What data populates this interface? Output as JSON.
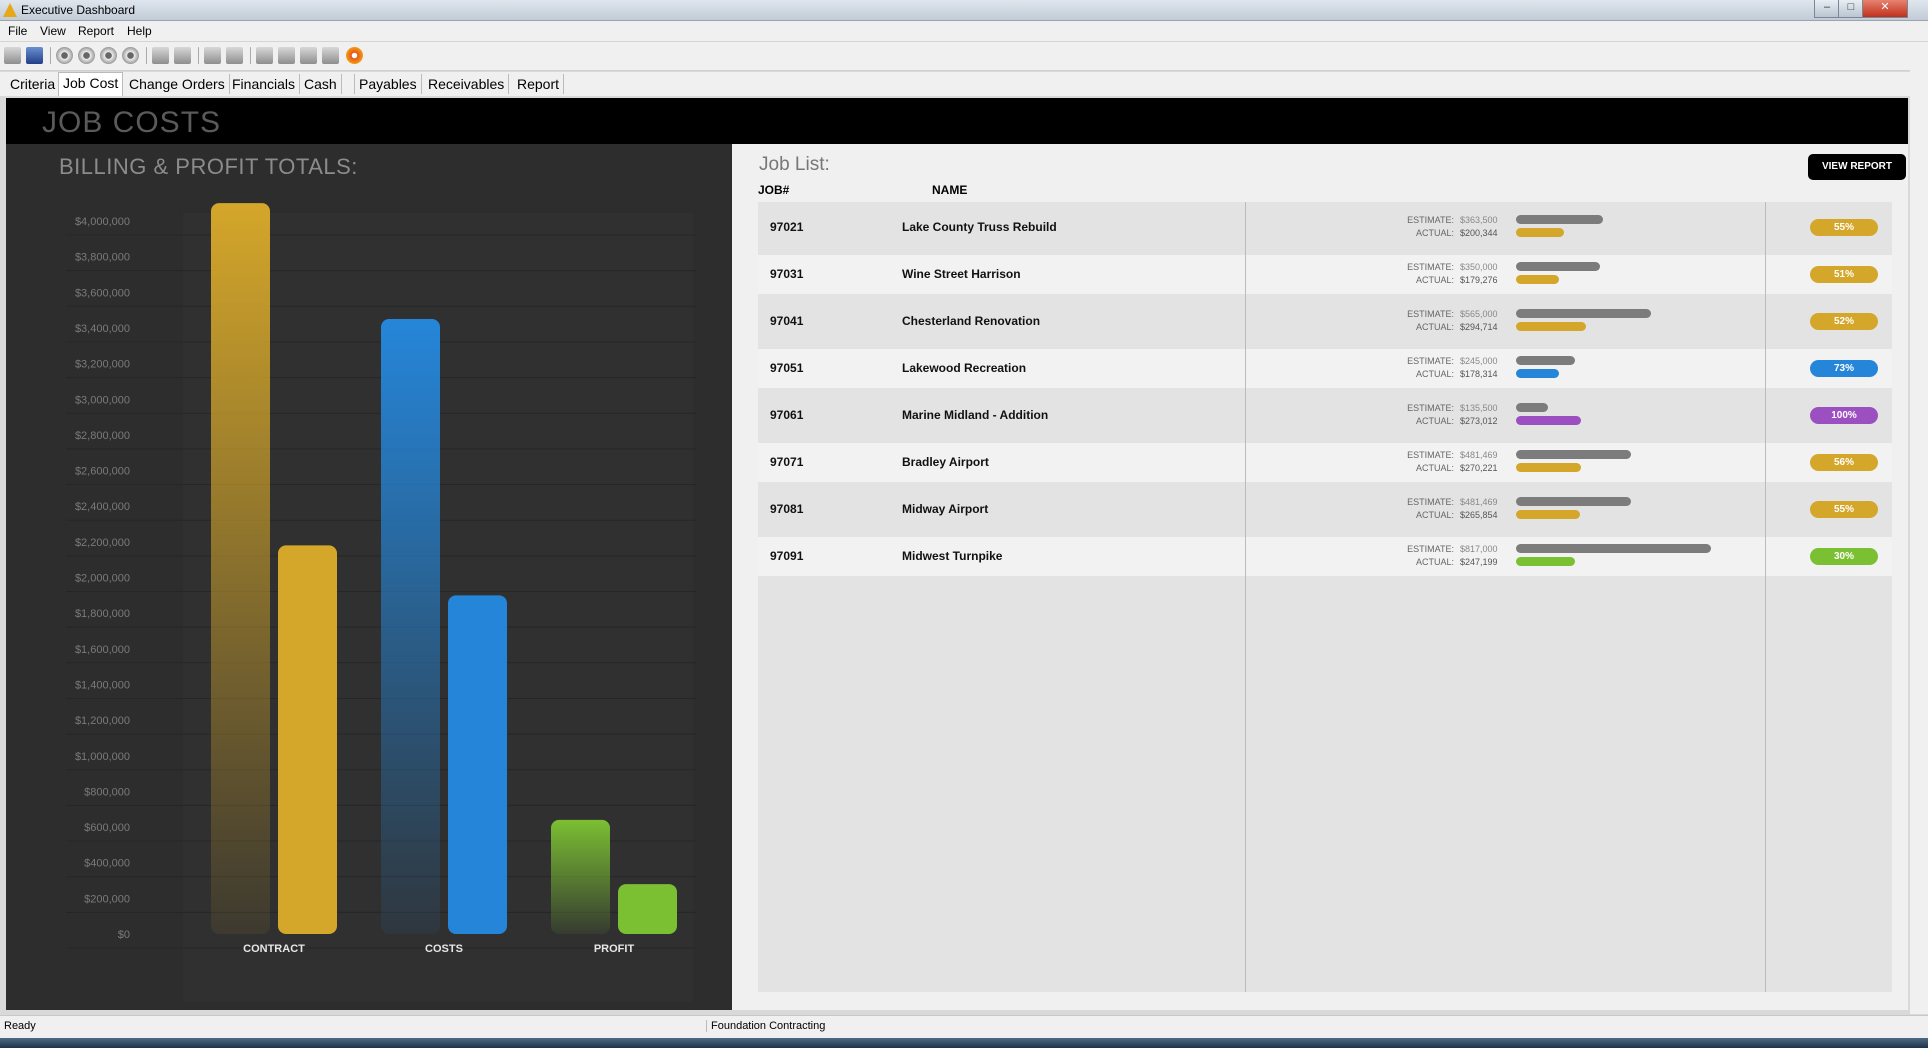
{
  "window": {
    "title": "Executive Dashboard",
    "minimize": "–",
    "maximize": "□",
    "close": "✕"
  },
  "menu": [
    "File",
    "View",
    "Report",
    "Help"
  ],
  "tabs": [
    "Criteria",
    "Job Cost",
    "Change Orders",
    "Financials",
    "Cash",
    "Payables",
    "Receivables",
    "Report"
  ],
  "active_tab": "Job Cost",
  "banner_title": "JOB COSTS",
  "left_panel": {
    "title": "BILLING & PROFIT TOTALS:"
  },
  "chart_data": {
    "type": "bar",
    "title": "BILLING & PROFIT TOTALS:",
    "categories": [
      "CONTRACT",
      "COSTS",
      "PROFIT"
    ],
    "series": [
      {
        "values": [
          4100000,
          3450000,
          640000
        ],
        "colors": [
          "#d4a62a",
          "#2586d9",
          "#7bbf32"
        ]
      },
      {
        "values": [
          2180000,
          1900000,
          280000
        ],
        "colors": [
          "#d4a62a",
          "#2586d9",
          "#7bbf32"
        ]
      }
    ],
    "yticks": [
      "$0",
      "$200,000",
      "$400,000",
      "$600,000",
      "$800,000",
      "$1,000,000",
      "$1,200,000",
      "$1,400,000",
      "$1,600,000",
      "$1,800,000",
      "$2,000,000",
      "$2,200,000",
      "$2,400,000",
      "$2,600,000",
      "$2,800,000",
      "$3,000,000",
      "$3,200,000",
      "$3,400,000",
      "$3,600,000",
      "$3,800,000",
      "$4,000,000"
    ],
    "ylim": [
      0,
      4000000
    ],
    "grid": true
  },
  "job_list": {
    "title": "Job List:",
    "view_report_label": "VIEW REPORT",
    "col_job": "JOB#",
    "col_name": "NAME",
    "estimate_label": "ESTIMATE:",
    "actual_label": "ACTUAL:",
    "jobs": [
      {
        "num": "97021",
        "name": "Lake County Truss Rebuild",
        "estimate": "$363,500",
        "actual": "$200,344",
        "pct": "55%",
        "est_value": 363500,
        "act_value": 200344,
        "color": "#d4a62a"
      },
      {
        "num": "97031",
        "name": "Wine Street Harrison",
        "estimate": "$350,000",
        "actual": "$179,276",
        "pct": "51%",
        "est_value": 350000,
        "act_value": 179276,
        "color": "#d4a62a"
      },
      {
        "num": "97041",
        "name": "Chesterland Renovation",
        "estimate": "$565,000",
        "actual": "$294,714",
        "pct": "52%",
        "est_value": 565000,
        "act_value": 294714,
        "color": "#d4a62a"
      },
      {
        "num": "97051",
        "name": "Lakewood Recreation",
        "estimate": "$245,000",
        "actual": "$178,314",
        "pct": "73%",
        "est_value": 245000,
        "act_value": 178314,
        "color": "#2586d9"
      },
      {
        "num": "97061",
        "name": "Marine Midland - Addition",
        "estimate": "$135,500",
        "actual": "$273,012",
        "pct": "100%",
        "est_value": 135500,
        "act_value": 273012,
        "color": "#9b4fc0"
      },
      {
        "num": "97071",
        "name": "Bradley Airport",
        "estimate": "$481,469",
        "actual": "$270,221",
        "pct": "56%",
        "est_value": 481469,
        "act_value": 270221,
        "color": "#d4a62a"
      },
      {
        "num": "97081",
        "name": "Midway Airport",
        "estimate": "$481,469",
        "actual": "$265,854",
        "pct": "55%",
        "est_value": 481469,
        "act_value": 265854,
        "color": "#d4a62a"
      },
      {
        "num": "97091",
        "name": "Midwest Turnpike",
        "estimate": "$817,000",
        "actual": "$247,199",
        "pct": "30%",
        "est_value": 817000,
        "act_value": 247199,
        "color": "#7bbf32"
      }
    ]
  },
  "status": {
    "left": "Ready",
    "right": "Foundation Contracting"
  }
}
